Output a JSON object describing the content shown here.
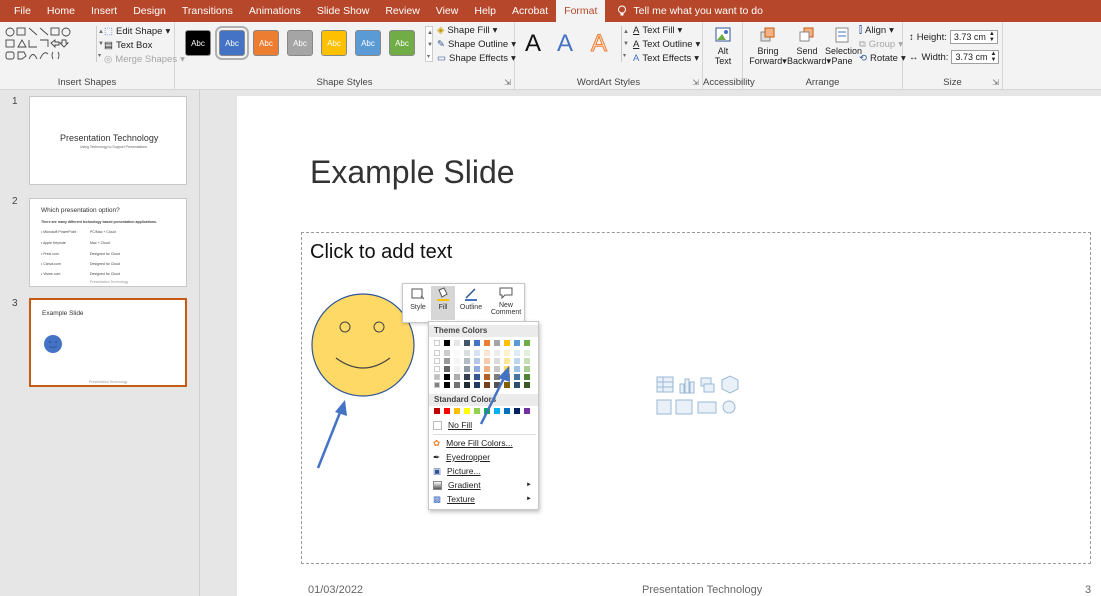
{
  "tabs": [
    "File",
    "Home",
    "Insert",
    "Design",
    "Transitions",
    "Animations",
    "Slide Show",
    "Review",
    "View",
    "Help",
    "Acrobat",
    "Format"
  ],
  "active_tab": "Format",
  "tell_me": "Tell me what you want to do",
  "ribbon": {
    "insert_shapes": {
      "edit_shape": "Edit Shape",
      "text_box": "Text Box",
      "merge_shapes": "Merge Shapes",
      "label": "Insert Shapes"
    },
    "shape_styles": {
      "swatch_label": "Abc",
      "shape_fill": "Shape Fill",
      "shape_outline": "Shape Outline",
      "shape_effects": "Shape Effects",
      "label": "Shape Styles",
      "swatch_colors": [
        "#000000",
        "#4472c4",
        "#ed7d31",
        "#a5a5a5",
        "#ffc000",
        "#5b9bd5",
        "#70ad47"
      ]
    },
    "wordart": {
      "glyph": "A",
      "text_fill": "Text Fill",
      "text_outline": "Text Outline",
      "text_effects": "Text Effects",
      "label": "WordArt Styles"
    },
    "accessibility": {
      "alt_text_1": "Alt",
      "alt_text_2": "Text",
      "label": "Accessibility"
    },
    "arrange": {
      "bring_1": "Bring",
      "bring_2": "Forward",
      "send_1": "Send",
      "send_2": "Backward",
      "selection_1": "Selection",
      "selection_2": "Pane",
      "align": "Align",
      "group": "Group",
      "rotate": "Rotate",
      "label": "Arrange"
    },
    "size": {
      "height_label": "Height:",
      "height_value": "3.73 cm",
      "width_label": "Width:",
      "width_value": "3.73 cm",
      "label": "Size"
    }
  },
  "thumbnails": [
    {
      "num": "1",
      "title": "Presentation Technology",
      "subtitle": "Using Technology to Support Presentations"
    },
    {
      "num": "2",
      "title": "Which presentation option?",
      "intro": "There are many different technology based presentation applications.",
      "rows": [
        {
          "left": "• Microsoft PowerPoint",
          "right": "PC/Mac + Cloud"
        },
        {
          "left": "• Apple Keynote",
          "right": "Mac + Cloud"
        },
        {
          "left": "• Prezi.com",
          "right": "Designed for Cloud"
        },
        {
          "left": "• Canva.com",
          "right": "Designed for Cloud"
        },
        {
          "left": "• Visme.com",
          "right": "Designed for Cloud"
        }
      ],
      "footer": "Presentation Technology"
    },
    {
      "num": "3",
      "title": "Example Slide",
      "footer": "Presentation Technology"
    }
  ],
  "slide": {
    "title": "Example Slide",
    "placeholder": "Click to add text",
    "footer_date": "01/03/2022",
    "footer_center": "Presentation Technology",
    "footer_page": "3"
  },
  "mini_toolbar": {
    "style": "Style",
    "fill": "Fill",
    "outline": "Outline",
    "new_comment_1": "New",
    "new_comment_2": "Comment"
  },
  "fill_menu": {
    "theme_colors": "Theme Colors",
    "standard_colors": "Standard Colors",
    "no_fill": "No Fill",
    "more_fill_colors": "More Fill Colors...",
    "eyedropper": "Eyedropper",
    "picture": "Picture...",
    "gradient": "Gradient",
    "texture": "Texture",
    "theme_palette": [
      "#ffffff",
      "#000000",
      "#e7e6e6",
      "#44546a",
      "#4472c4",
      "#ed7d31",
      "#a5a5a5",
      "#ffc000",
      "#5b9bd5",
      "#70ad47"
    ],
    "standard_palette": [
      "#c00000",
      "#ff0000",
      "#ffc000",
      "#ffff00",
      "#92d050",
      "#00b050",
      "#00b0f0",
      "#0070c0",
      "#002060",
      "#7030a0"
    ]
  },
  "colors": {
    "accent": "#b7472a",
    "smiley_fill": "#ffd966",
    "arrow": "#4472c4"
  }
}
